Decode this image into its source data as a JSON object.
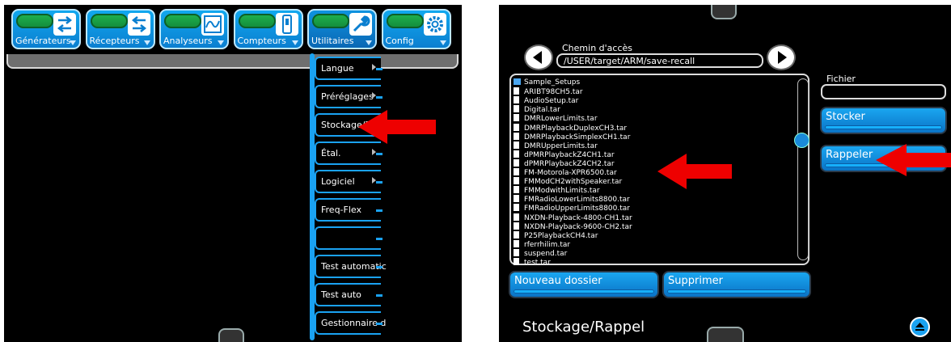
{
  "left": {
    "top_buttons": [
      {
        "label": "Générateurs",
        "icon": "generator-icon"
      },
      {
        "label": "Récepteurs",
        "icon": "receiver-icon"
      },
      {
        "label": "Analyseurs",
        "icon": "analyzer-icon"
      },
      {
        "label": "Compteurs",
        "icon": "meter-icon"
      },
      {
        "label": "Utilitaires",
        "icon": "wrench-icon"
      },
      {
        "label": "Config",
        "icon": "gear-icon"
      }
    ],
    "menu_items": [
      {
        "label": "Langue",
        "submenu": true
      },
      {
        "label": "Préréglages",
        "submenu": true
      },
      {
        "label": "Stockage/R",
        "submenu": true
      },
      {
        "label": "Étal.",
        "submenu": true
      },
      {
        "label": "Logiciel",
        "submenu": true
      },
      {
        "label": "Freq-Flex",
        "submenu": false
      },
      {
        "label": "",
        "submenu": false
      },
      {
        "label": "Test automatic",
        "submenu": false
      },
      {
        "label": "Test auto",
        "submenu": false
      },
      {
        "label": "Gestionnaire d",
        "submenu": false
      }
    ]
  },
  "right": {
    "path_title": "Chemin d'accès",
    "path_value": "/USER/target/ARM/save-recall",
    "files": [
      {
        "name": "Sample_Setups",
        "type": "folder"
      },
      {
        "name": "ARIBT98CH5.tar",
        "type": "file"
      },
      {
        "name": "AudioSetup.tar",
        "type": "file"
      },
      {
        "name": "Digital.tar",
        "type": "file"
      },
      {
        "name": "DMRLowerLimits.tar",
        "type": "file"
      },
      {
        "name": "DMRPlaybackDuplexCH3.tar",
        "type": "file"
      },
      {
        "name": "DMRPlaybackSimplexCH1.tar",
        "type": "file"
      },
      {
        "name": "DMRUpperLimits.tar",
        "type": "file"
      },
      {
        "name": "dPMRPlaybackZ4CH1.tar",
        "type": "file"
      },
      {
        "name": "dPMRPlaybackZ4CH2.tar",
        "type": "file"
      },
      {
        "name": "FM-Motorola-XPR6500.tar",
        "type": "file"
      },
      {
        "name": "FMModCH2withSpeaker.tar",
        "type": "file"
      },
      {
        "name": "FMModwithLimits.tar",
        "type": "file"
      },
      {
        "name": "FMRadioLowerLimits8800.tar",
        "type": "file"
      },
      {
        "name": "FMRadioUpperLimits8800.tar",
        "type": "file"
      },
      {
        "name": "NXDN-Playback-4800-CH1.tar",
        "type": "file"
      },
      {
        "name": "NXDN-Playback-9600-CH2.tar",
        "type": "file"
      },
      {
        "name": "P25PlaybackCH4.tar",
        "type": "file"
      },
      {
        "name": "rferrhilim.tar",
        "type": "file"
      },
      {
        "name": "suspend.tar",
        "type": "file"
      },
      {
        "name": "test.tar",
        "type": "file"
      }
    ],
    "fichier_label": "Fichier",
    "fichier_value": "",
    "stocker_label": "Stocker",
    "rappeler_label": "Rappeler",
    "new_folder_label": "Nouveau dossier",
    "delete_label": "Supprimer",
    "page_title": "Stockage/Rappel"
  },
  "colors": {
    "accent": "#1aa2f2",
    "arrow": "#ee0000",
    "cap_green": "#1fb34f"
  }
}
